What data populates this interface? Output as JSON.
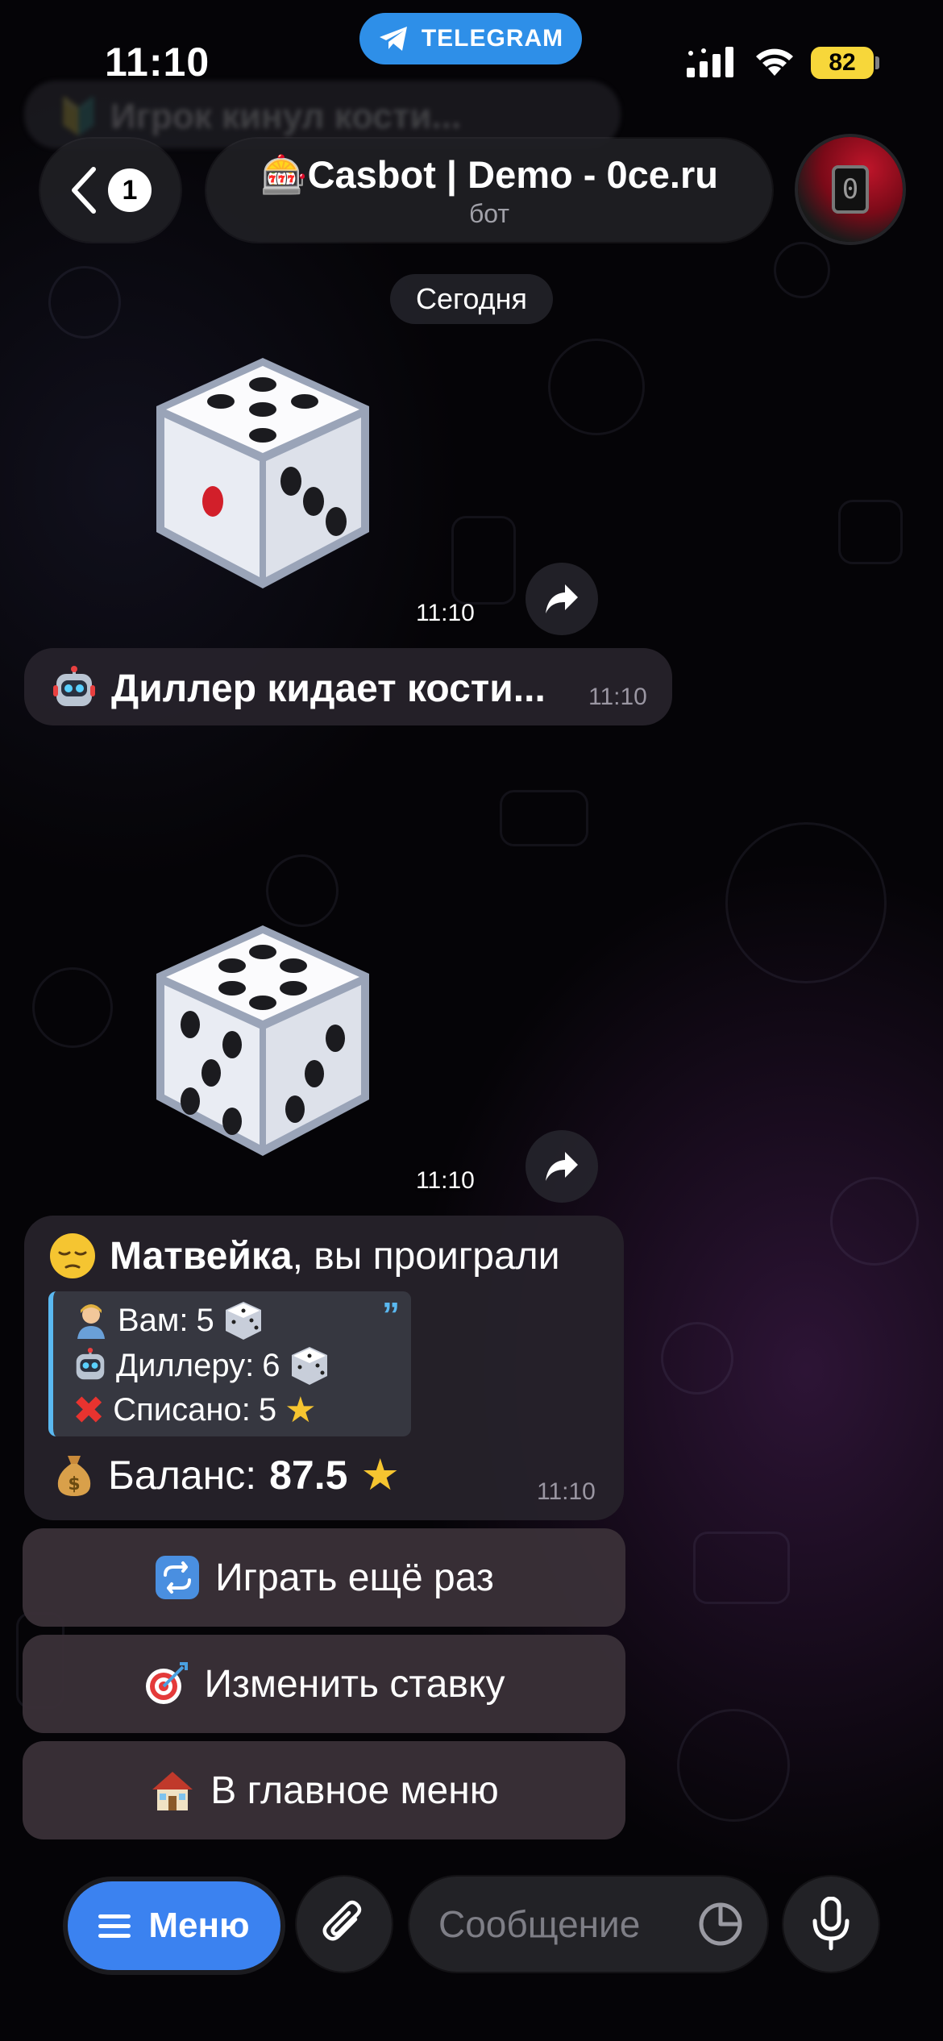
{
  "status_bar": {
    "time": "11:10",
    "return_app": "TELEGRAM",
    "battery": "82"
  },
  "notice_blurred": "🔰 Игрок кинул кости...",
  "header": {
    "back_badge": "1",
    "title": "🎰Casbot | Demo - 0ce.ru",
    "subtitle": "бот",
    "avatar_glyph": "0"
  },
  "date_chip": "Сегодня",
  "messages": {
    "dice1": {
      "value": 1,
      "time": "11:10"
    },
    "dealer": {
      "text": "Диллер кидает кости...",
      "time": "11:10"
    },
    "dice2": {
      "value": 6,
      "time": "11:10"
    },
    "result": {
      "name": "Матвейка",
      "headline_rest": ", вы проиграли",
      "lines": [
        {
          "label": "Вам:",
          "value": "5"
        },
        {
          "label": "Диллеру:",
          "value": "6"
        },
        {
          "label": "Списано:",
          "value": "5"
        }
      ],
      "balance_label": "Баланс:",
      "balance_value": "87.5",
      "time": "11:10"
    }
  },
  "keyboard": {
    "play_again": "Играть ещё раз",
    "change_bet": "Изменить ставку",
    "main_menu": "В главное меню"
  },
  "bottom_bar": {
    "menu_label": "Меню",
    "input_placeholder": "Сообщение"
  },
  "colors": {
    "accent_blue": "#3b82f0",
    "telegram_blue": "#2e8fe8",
    "quote_bar": "#5ab8f0",
    "battery_yellow": "#f7d73a"
  }
}
